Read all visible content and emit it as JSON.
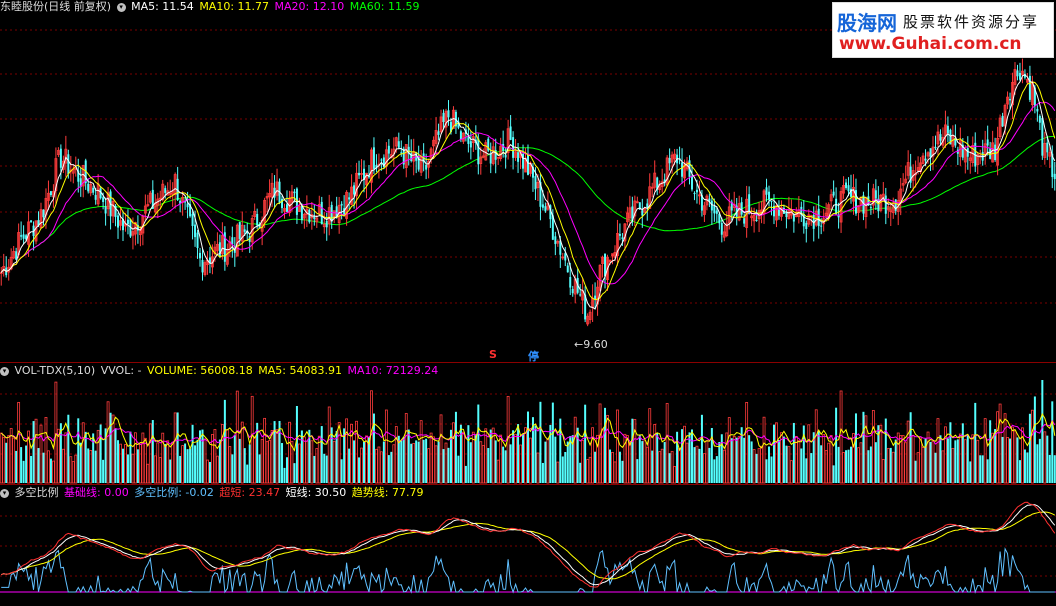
{
  "main_header": {
    "stock": "东睦股份(日线 前复权)",
    "ma5": "MA5: 11.54",
    "ma10": "MA10: 11.77",
    "ma20": "MA20: 12.10",
    "ma60": "MA60: 11.59"
  },
  "vol_header": {
    "name": "VOL-TDX(5,10)",
    "vvol": "VVOL: -",
    "volume": "VOLUME: 56008.18",
    "ma5": "MA5: 54083.91",
    "ma10": "MA10: 72129.24"
  },
  "ind_header": {
    "name": "多空比例",
    "base": "基础线: 0.00",
    "ratio": "多空比例: -0.02",
    "overshort": "超短: 23.47",
    "short": "短线: 30.50",
    "trend": "趋势线: 77.79"
  },
  "annotations": {
    "low_price": "←9.60",
    "signal_s": "S",
    "signal_stop": "停"
  },
  "watermark": {
    "logo": "股海网",
    "slogan": "股票软件资源分享",
    "url": "www.Guhai.com.cn"
  },
  "colors": {
    "up": "#ff3c3c",
    "down": "#54ffff",
    "ma5": "#ffffff",
    "ma10": "#ffff00",
    "ma20": "#ff00ff",
    "ma60": "#00ff00",
    "grid": "#7a0000",
    "overshort": "#ff3030",
    "short": "#ffffff",
    "trend": "#ffff00",
    "ratio": "#60c0ff"
  },
  "chart_data": [
    {
      "type": "candlestick",
      "title": "东睦股份(日线 前复权)",
      "annotation_low": 9.6,
      "price_range_approx": [
        9.5,
        16.0
      ],
      "ma_last": {
        "MA5": 11.54,
        "MA10": 11.77,
        "MA20": 12.1,
        "MA60": 11.59
      },
      "trend_points": [
        [
          0,
          10.8
        ],
        [
          8,
          11.6
        ],
        [
          16,
          12.2
        ],
        [
          24,
          13.6
        ],
        [
          30,
          13.2
        ],
        [
          40,
          12.7
        ],
        [
          50,
          11.8
        ],
        [
          60,
          12.4
        ],
        [
          70,
          13.0
        ],
        [
          80,
          11.1
        ],
        [
          90,
          11.4
        ],
        [
          100,
          11.8
        ],
        [
          110,
          12.8
        ],
        [
          120,
          12.4
        ],
        [
          130,
          12.2
        ],
        [
          140,
          12.6
        ],
        [
          150,
          13.6
        ],
        [
          160,
          13.8
        ],
        [
          170,
          13.2
        ],
        [
          176,
          14.1
        ],
        [
          180,
          14.6
        ],
        [
          186,
          14.0
        ],
        [
          195,
          13.6
        ],
        [
          205,
          14.0
        ],
        [
          212,
          13.3
        ],
        [
          220,
          12.2
        ],
        [
          230,
          10.6
        ],
        [
          236,
          9.8
        ],
        [
          240,
          10.7
        ],
        [
          250,
          11.8
        ],
        [
          262,
          12.8
        ],
        [
          272,
          13.6
        ],
        [
          280,
          12.7
        ],
        [
          290,
          12.0
        ],
        [
          300,
          12.3
        ],
        [
          310,
          12.5
        ],
        [
          320,
          12.2
        ],
        [
          330,
          12.2
        ],
        [
          340,
          12.6
        ],
        [
          350,
          12.5
        ],
        [
          360,
          12.6
        ],
        [
          370,
          13.7
        ],
        [
          380,
          14.1
        ],
        [
          390,
          13.6
        ],
        [
          400,
          13.8
        ],
        [
          405,
          15.2
        ],
        [
          410,
          15.8
        ],
        [
          415,
          15.2
        ],
        [
          420,
          13.6
        ],
        [
          424,
          13.2
        ]
      ]
    },
    {
      "type": "bar",
      "title": "VOL-TDX(5,10)",
      "series": [
        {
          "name": "VOLUME",
          "last": 56008.18
        },
        {
          "name": "MA5",
          "last": 54083.91
        },
        {
          "name": "MA10",
          "last": 72129.24
        }
      ]
    },
    {
      "type": "line",
      "title": "多空比例",
      "series": [
        {
          "name": "基础线",
          "last": 0.0
        },
        {
          "name": "多空比例",
          "last": -0.02
        },
        {
          "name": "超短",
          "last": 23.47
        },
        {
          "name": "短线",
          "last": 30.5
        },
        {
          "name": "趋势线",
          "last": 77.79
        }
      ]
    }
  ]
}
